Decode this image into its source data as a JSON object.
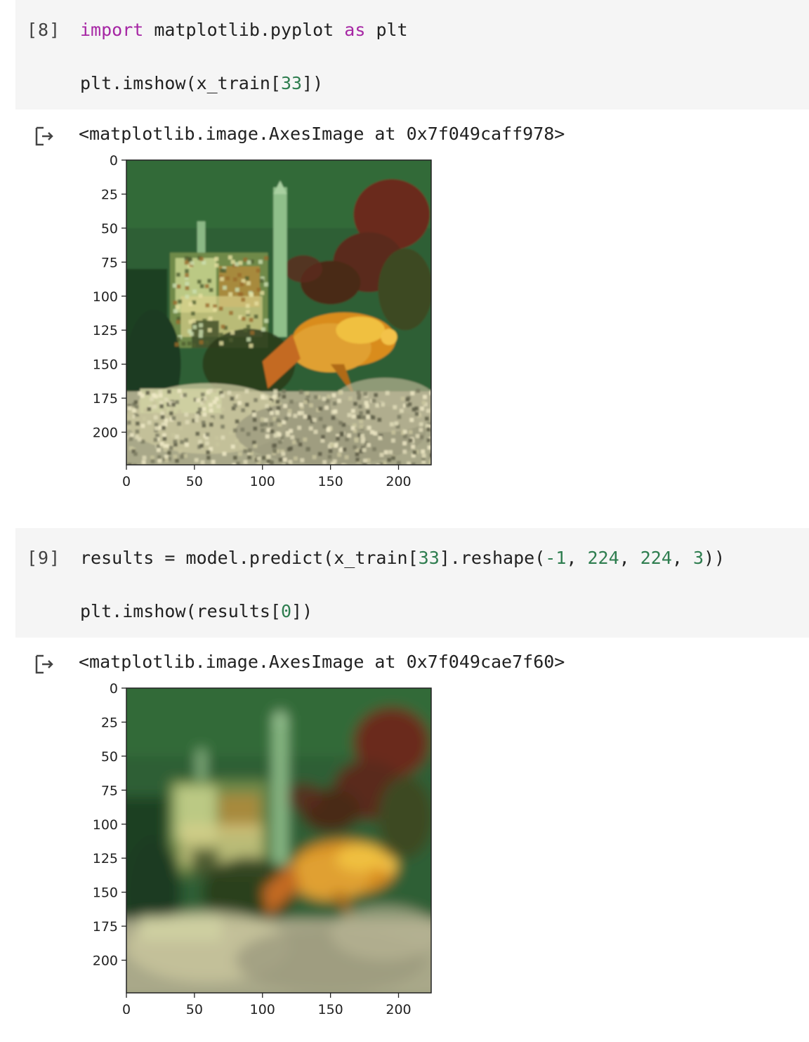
{
  "cells": [
    {
      "exec_count": "[8]",
      "code": {
        "line1": {
          "kw": "import",
          "mid": " matplotlib.pyplot ",
          "kw2": "as",
          "end": " plt"
        },
        "line2": {
          "pre": "plt.imshow(x_train[",
          "num": "33",
          "post": "])"
        }
      },
      "output_text": "<matplotlib.image.AxesImage at 0x7f049caff978>"
    },
    {
      "exec_count": "[9]",
      "code": {
        "line1": {
          "pre": "results = model.predict(x_train[",
          "n1": "33",
          "mid1": "].reshape(",
          "n2": "-1",
          "sep1": ", ",
          "n3": "224",
          "sep2": ", ",
          "n4": "224",
          "sep3": ", ",
          "n5": "3",
          "post": "))"
        },
        "line2": {
          "pre": "plt.imshow(results[",
          "num": "0",
          "post": "])"
        }
      },
      "output_text": "<matplotlib.image.AxesImage at 0x7f049cae7f60>"
    }
  ],
  "icons": {
    "output": "output-arrow-icon"
  },
  "colors": {
    "keyword": "#a626a4",
    "number": "#2e7d4f",
    "cell_bg": "#f5f5f5"
  },
  "chart_data": [
    {
      "type": "image",
      "image_content": "goldfish in an aquarium with a castle ornament and gravel",
      "xlim": [
        0,
        224
      ],
      "ylim": [
        224,
        0
      ],
      "xticks": [
        "0",
        "50",
        "100",
        "150",
        "200"
      ],
      "yticks": [
        "0",
        "25",
        "50",
        "75",
        "100",
        "125",
        "150",
        "175",
        "200"
      ],
      "xtick_values": [
        0,
        50,
        100,
        150,
        200
      ],
      "ytick_values": [
        0,
        25,
        50,
        75,
        100,
        125,
        150,
        175,
        200
      ],
      "blurred": false
    },
    {
      "type": "image",
      "image_content": "blurred reconstruction of the goldfish aquarium image",
      "xlim": [
        0,
        224
      ],
      "ylim": [
        224,
        0
      ],
      "xticks": [
        "0",
        "50",
        "100",
        "150",
        "200"
      ],
      "yticks": [
        "0",
        "25",
        "50",
        "75",
        "100",
        "125",
        "150",
        "175",
        "200"
      ],
      "xtick_values": [
        0,
        50,
        100,
        150,
        200
      ],
      "ytick_values": [
        0,
        25,
        50,
        75,
        100,
        125,
        150,
        175,
        200
      ],
      "blurred": true
    }
  ]
}
